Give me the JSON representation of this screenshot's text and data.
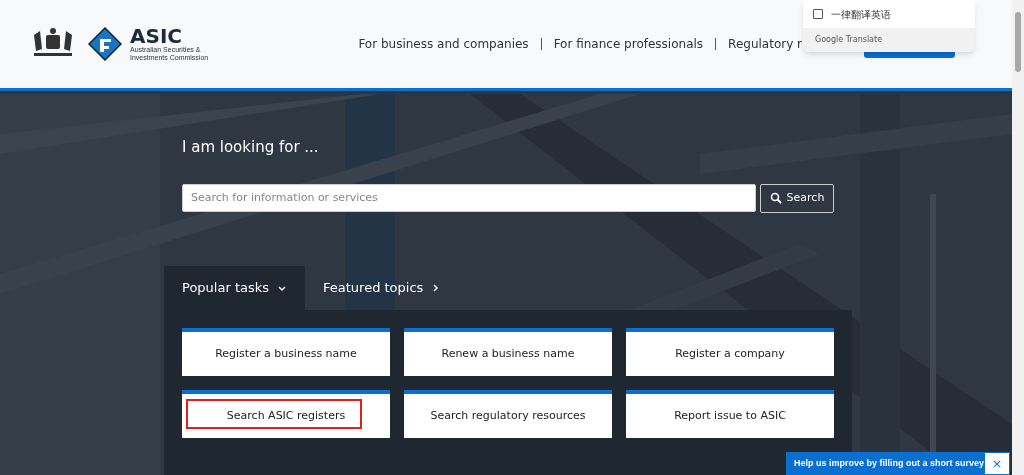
{
  "header": {
    "logo": {
      "title": "ASIC",
      "subtitle_lines": [
        "Australian Securities &",
        "Investments Commission"
      ]
    },
    "nav": [
      "For business and companies",
      "For finance professionals",
      "Regulatory r"
    ]
  },
  "translate_popup": {
    "option": {
      "label": "一律翻译英语",
      "checked": false
    },
    "footer": "Google Translate"
  },
  "hero": {
    "heading": "I am looking for ...",
    "search": {
      "placeholder": "Search for information or services",
      "button": "Search"
    }
  },
  "task_tabs": [
    {
      "label": "Popular tasks",
      "selected": true,
      "expanded": true
    },
    {
      "label": "Featured topics",
      "selected": false,
      "expanded": false
    }
  ],
  "tasks": [
    {
      "label": "Register a business name",
      "highlighted": false
    },
    {
      "label": "Renew a business name",
      "highlighted": false
    },
    {
      "label": "Register a company",
      "highlighted": false
    },
    {
      "label": "Search ASIC registers",
      "highlighted": true
    },
    {
      "label": "Search regulatory resources",
      "highlighted": false
    },
    {
      "label": "Report issue to ASIC",
      "highlighted": false
    }
  ],
  "survey_banner": {
    "text": "Help us improve by filling out a short survey",
    "close": "×"
  }
}
